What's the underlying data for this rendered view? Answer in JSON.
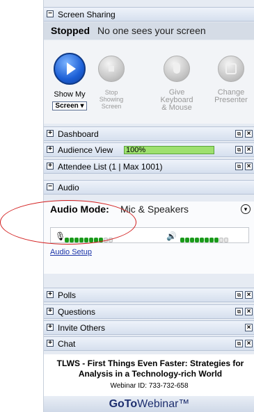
{
  "screen_sharing": {
    "header": "Screen Sharing",
    "status_label": "Stopped",
    "status_message": "No one sees your screen",
    "tools": [
      {
        "label": "Show My",
        "dropdown": "Screen"
      },
      {
        "label": "Stop\nShowing\nScreen"
      },
      {
        "label": "Give\nKeyboard\n& Mouse"
      },
      {
        "label": "Change\nPresenter"
      }
    ]
  },
  "sections": {
    "dashboard": "Dashboard",
    "audience_view": "Audience View",
    "audience_percent": "100%",
    "attendee_list": "Attendee List  (1 | Max 1001)",
    "audio": "Audio",
    "polls": "Polls",
    "questions": "Questions",
    "invite_others": "Invite Others",
    "chat": "Chat"
  },
  "audio": {
    "mode_label": "Audio Mode:",
    "mode_value": "Mic & Speakers",
    "mic_level": 0.8,
    "speaker_level": 0.8,
    "setup_link": "Audio Setup"
  },
  "footer": {
    "title": "TLWS - First Things Even Faster: Strategies for Analysis in a Technology-rich World",
    "webinar_id": "Webinar ID: 733-732-658",
    "brand_bold": "GoTo",
    "brand_rest": "Webinar™"
  },
  "colors": {
    "accent_blue": "#1c5fd6",
    "meter_green": "#1a9a1a",
    "annotation_red": "#d32020"
  }
}
